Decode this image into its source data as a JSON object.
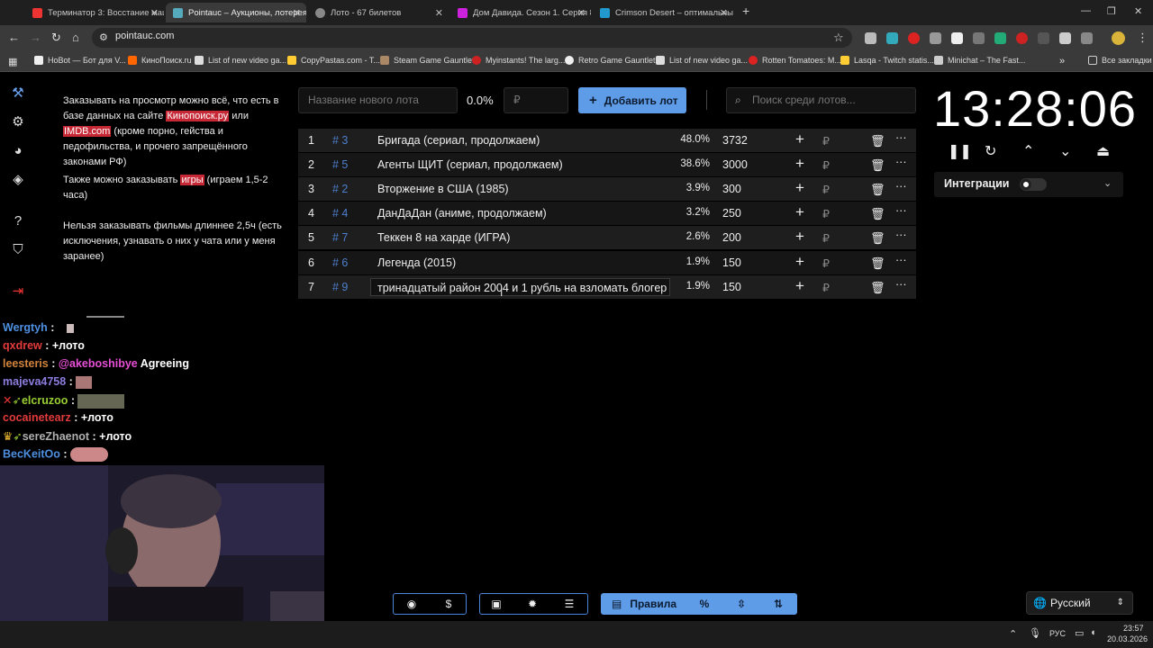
{
  "browser": {
    "tabs": [
      {
        "label": "Терминатор 3: Восстание маш",
        "color": "#e33"
      },
      {
        "label": "Pointauc – Аукционы, лотерея",
        "color": "#5ab"
      },
      {
        "label": "Лото - 67 билетов",
        "color": "#888"
      },
      {
        "label": "Дом Давида. Сезон 1. Серия 8",
        "color": "#c2d"
      },
      {
        "label": "Crimson Desert – оптимальны",
        "color": "#29c"
      }
    ],
    "url": "pointauc.com",
    "bookmarks": [
      "HoBot — Бот для V...",
      "КиноПоиск.ru",
      "List of new video ga...",
      "CopyPastas.com - T...",
      "Steam Game Gauntlet",
      "Myinstants! The larg...",
      "Retro Game Gauntlet",
      "List of new video ga...",
      "Rotten Tomatoes: M...",
      "Lasqa - Twitch statis...",
      "Minichat – The Fast..."
    ],
    "all_bookmarks": "Все закладки"
  },
  "rules": {
    "p1_a": "Заказывать на просмотр можно всё, что есть в базе данных на сайте ",
    "p1_link1": "Кинопоиск.ру",
    "p1_b": " или ",
    "p1_link2": "IMDB.com",
    "p1_c": " (кроме порно, гейства и педофильства, и прочего запрещённого законами РФ)",
    "p2_a": "Также можно заказывать ",
    "p2_link": "игры",
    "p2_b": " (играем 1,5-2 часа)",
    "p3": "Нельзя заказывать фильмы длиннее 2,5ч (есть исключения, узнавать о них у чата или у меня заранее)"
  },
  "controls": {
    "new_lot_placeholder": "Название нового лота",
    "percent": "0.0%",
    "rub_placeholder": "₽",
    "add_button": "Добавить лот",
    "search_placeholder": "Поиск среди лотов..."
  },
  "lots": [
    {
      "idx": "1",
      "id": "# 3",
      "name": "Бригада (сериал, продолжаем)",
      "pct": "48.0%",
      "amount": "3732"
    },
    {
      "idx": "2",
      "id": "# 5",
      "name": "Агенты ЩИТ (сериал, продолжаем)",
      "pct": "38.6%",
      "amount": "3000"
    },
    {
      "idx": "3",
      "id": "# 2",
      "name": "Вторжение в США (1985)",
      "pct": "3.9%",
      "amount": "300"
    },
    {
      "idx": "4",
      "id": "# 4",
      "name": "ДанДаДан (аниме, продолжаем)",
      "pct": "3.2%",
      "amount": "250"
    },
    {
      "idx": "5",
      "id": "# 7",
      "name": "Теккен 8 на харде (ИГРА)",
      "pct": "2.6%",
      "amount": "200"
    },
    {
      "idx": "6",
      "id": "# 6",
      "name": "Легенда (2015)",
      "pct": "1.9%",
      "amount": "150"
    },
    {
      "idx": "7",
      "id": "# 9",
      "name": "тринадцатый район 2004 и 1 рубль на взломать блогер",
      "pct": "1.9%",
      "amount": "150"
    }
  ],
  "row_symbols": {
    "plus": "+",
    "rub": "₽",
    "more": "···"
  },
  "timer": {
    "time": "13:28:06"
  },
  "integrations": {
    "label": "Интеграции"
  },
  "chat": [
    {
      "user": "Wergtyh",
      "user_color": "#4e8fe0",
      "message": ""
    },
    {
      "user": "qxdrew",
      "user_color": "#e33b3b",
      "message": "+лото"
    },
    {
      "user": "leesteris",
      "user_color": "#d2833b",
      "message": "@akeboshibye Agreeing",
      "msg_color": "#e54fd3"
    },
    {
      "user": "majeva4758",
      "user_color": "#8e7de0",
      "message": ""
    },
    {
      "user": "elcruzoo",
      "user_color": "#9acd32",
      "message": ""
    },
    {
      "user": "cocainetearz",
      "user_color": "#e33b3b",
      "message": "+лото"
    },
    {
      "user": "sereZhaenot",
      "user_color": "#b0b0b0",
      "message": "+лото"
    },
    {
      "user": "BecKeitOo",
      "user_color": "#4e8fe0",
      "message": ""
    }
  ],
  "footer": {
    "rules_button": "Правила",
    "percent_symbol": "%",
    "language": "Русский"
  },
  "taskbar": {
    "lang": "РУС",
    "time": "23:57",
    "date": "20.03.2026"
  }
}
